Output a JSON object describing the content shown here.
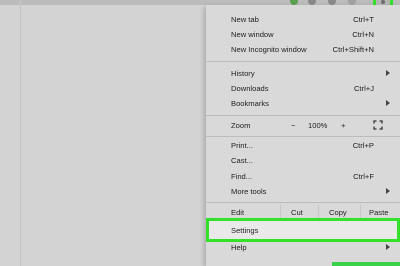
{
  "menu": {
    "new_tab": {
      "label": "New tab",
      "shortcut": "Ctrl+T"
    },
    "new_window": {
      "label": "New window",
      "shortcut": "Ctrl+N"
    },
    "new_incognito": {
      "label": "New Incognito window",
      "shortcut": "Ctrl+Shift+N"
    },
    "history": {
      "label": "History"
    },
    "downloads": {
      "label": "Downloads",
      "shortcut": "Ctrl+J"
    },
    "bookmarks": {
      "label": "Bookmarks"
    },
    "zoom": {
      "label": "Zoom",
      "minus": "−",
      "level": "100%",
      "plus": "+"
    },
    "print": {
      "label": "Print...",
      "shortcut": "Ctrl+P"
    },
    "cast": {
      "label": "Cast..."
    },
    "find": {
      "label": "Find...",
      "shortcut": "Ctrl+F"
    },
    "more_tools": {
      "label": "More tools"
    },
    "edit": {
      "label": "Edit",
      "cut": "Cut",
      "copy": "Copy",
      "paste": "Paste"
    },
    "settings": {
      "label": "Settings"
    },
    "help": {
      "label": "Help"
    }
  },
  "colors": {
    "highlight": "#35e02a",
    "menu_bg": "#d9d9d9",
    "page_bg": "#d3d3d3"
  },
  "icons": {
    "menu": "three-dot-menu-icon",
    "submenu": "chevron-right-icon",
    "fullscreen": "fullscreen-icon"
  }
}
